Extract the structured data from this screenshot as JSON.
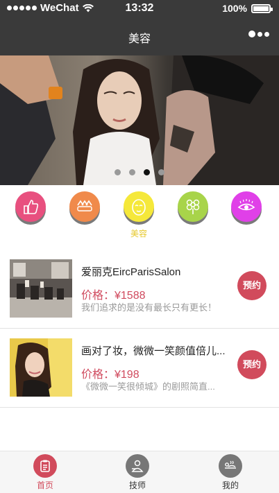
{
  "status_bar": {
    "carrier": "WeChat",
    "time": "13:32",
    "battery": "100%"
  },
  "nav": {
    "title": "美容"
  },
  "banner": {
    "pages": 4,
    "active_page": 3
  },
  "categories": [
    {
      "icon": "thumbs-up-icon",
      "color": "#e8507f",
      "label": ""
    },
    {
      "icon": "nail-icon",
      "color": "#f08a4b",
      "label": ""
    },
    {
      "icon": "face-icon",
      "color": "#f5e83a",
      "label": "美容"
    },
    {
      "icon": "flower-icon",
      "color": "#a8d44a",
      "label": ""
    },
    {
      "icon": "eye-icon",
      "color": "#e040e8",
      "label": ""
    }
  ],
  "items": [
    {
      "title": "爱丽克EircParisSalon",
      "price": "价格：¥1588",
      "desc": "我们追求的是没有最长只有更长！",
      "button": "预约"
    },
    {
      "title": "画对了妆，微微一笑颜值倍儿...",
      "price": "价格：¥198",
      "desc": "《微微一笑很倾城》的剧照简直...",
      "button": "预约"
    }
  ],
  "tabbar": {
    "tabs": [
      {
        "label": "首页",
        "icon": "clipboard-icon",
        "active": true
      },
      {
        "label": "技师",
        "icon": "technician-icon",
        "active": false
      },
      {
        "label": "我的",
        "icon": "massage-icon",
        "active": false
      }
    ]
  },
  "colors": {
    "accent": "#d14b5c",
    "nav_bg": "#3a3a3a",
    "category_label": "#e6c82c",
    "price": "#d04a5e"
  }
}
